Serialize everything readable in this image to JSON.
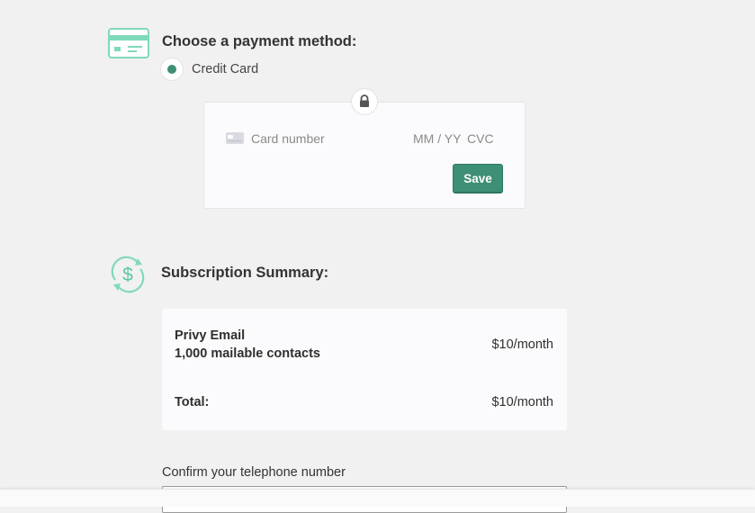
{
  "payment": {
    "title": "Choose a payment method:",
    "icon": "credit-card-icon",
    "method_label": "Credit Card",
    "method_selected": true,
    "card_form": {
      "card_number_placeholder": "Card number",
      "expiry_placeholder": "MM / YY",
      "cvc_placeholder": "CVC",
      "save_label": "Save",
      "lock_icon": "lock-icon"
    }
  },
  "subscription": {
    "title": "Subscription Summary:",
    "icon": "recurring-dollar-icon",
    "plan_name": "Privy Email",
    "plan_contacts": "1,000 mailable contacts",
    "plan_price": "$10/month",
    "total_label": "Total:",
    "total_price": "$10/month"
  },
  "phone": {
    "label": "Confirm your telephone number",
    "value": ""
  },
  "colors": {
    "accent": "#3d8f75",
    "icon_teal": "#7fd9bd",
    "background": "#f1f1f1",
    "panel": "#fbfbfd"
  }
}
